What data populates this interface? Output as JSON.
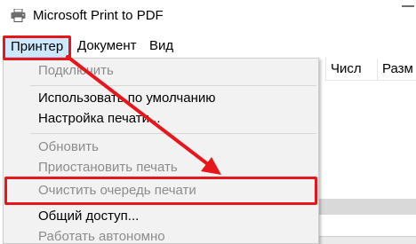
{
  "window": {
    "title": "Microsoft Print to PDF",
    "icon": "printer-icon"
  },
  "menubar": {
    "items": [
      {
        "label": "Принтер",
        "active": true
      },
      {
        "label": "Документ"
      },
      {
        "label": "Вид"
      }
    ]
  },
  "columns": [
    {
      "label": "Числ"
    },
    {
      "label": "Разм"
    }
  ],
  "printer_menu": {
    "items": [
      {
        "label": "Подключить",
        "enabled": false
      },
      {
        "label": "Использовать по умолчанию",
        "enabled": true
      },
      {
        "label": "Настройка печати...",
        "enabled": true
      },
      {
        "label": "Обновить",
        "enabled": false
      },
      {
        "label": "Приостановить печать",
        "enabled": false
      },
      {
        "label": "Очистить очередь печати",
        "enabled": false,
        "highlighted": true
      },
      {
        "label": "Общий доступ...",
        "enabled": true
      },
      {
        "label": "Работать автономно",
        "enabled": false
      }
    ]
  },
  "colors": {
    "annotation": "#e8161b",
    "menu_active_bg": "#cce8ff",
    "disabled_text": "#8c8c8c"
  }
}
